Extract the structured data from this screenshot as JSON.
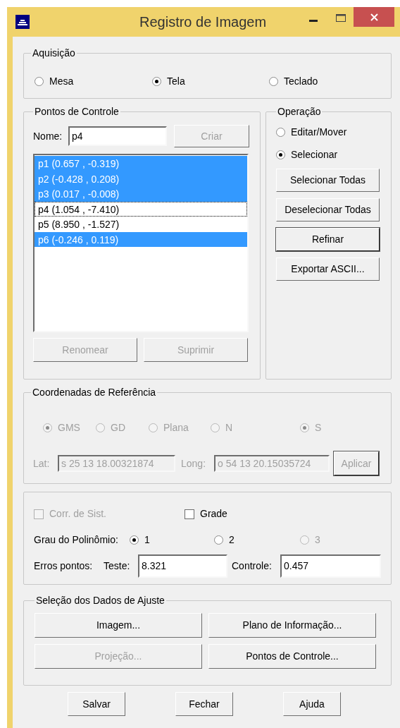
{
  "window": {
    "title": "Registro de Imagem"
  },
  "acquisition": {
    "label": "Aquisição",
    "options": [
      {
        "label": "Mesa",
        "selected": false
      },
      {
        "label": "Tela",
        "selected": true
      },
      {
        "label": "Teclado",
        "selected": false
      }
    ]
  },
  "control_points": {
    "label": "Pontos de Controle",
    "name_label": "Nome:",
    "name_value": "p4",
    "create_button": {
      "label": "Criar",
      "disabled": true
    },
    "points": [
      {
        "label": "p1 (0.657 , -0.319)",
        "selected": true,
        "focused": false
      },
      {
        "label": "p2 (-0.428 , 0.208)",
        "selected": true,
        "focused": false
      },
      {
        "label": "p3 (0.017 , -0.008)",
        "selected": true,
        "focused": false
      },
      {
        "label": "p4 (1.054 , -7.410)",
        "selected": false,
        "focused": true
      },
      {
        "label": "p5 (8.950 , -1.527)",
        "selected": false,
        "focused": false
      },
      {
        "label": "p6 (-0.246 , 0.119)",
        "selected": true,
        "focused": false
      }
    ],
    "buttons": [
      {
        "label": "Renomear",
        "disabled": true
      },
      {
        "label": "Suprimir",
        "disabled": true
      }
    ]
  },
  "operation": {
    "label": "Operação",
    "options": [
      {
        "label": "Editar/Mover",
        "selected": false
      },
      {
        "label": "Selecionar",
        "selected": true
      }
    ],
    "buttons": [
      {
        "label": "Selecionar Todas",
        "default": false
      },
      {
        "label": "Deselecionar Todas",
        "default": false
      },
      {
        "label": "Refinar",
        "default": true
      },
      {
        "label": "Exportar ASCII...",
        "default": false
      }
    ]
  },
  "reference": {
    "label": "Coordenadas de Referência",
    "options": [
      {
        "label": "GMS",
        "selected": true,
        "disabled": true
      },
      {
        "label": "GD",
        "selected": false,
        "disabled": true
      },
      {
        "label": "Plana",
        "selected": false,
        "disabled": true
      },
      {
        "label": "N",
        "selected": false,
        "disabled": true
      },
      {
        "label": "S",
        "selected": true,
        "disabled": true
      }
    ],
    "lat_label": "Lat:",
    "lat_value": "s 25 13 18.00321874",
    "long_label": "Long:",
    "long_value": "o 54 13 20.15035724",
    "apply_button": "Aplicar"
  },
  "adjustment": {
    "checkboxes": [
      {
        "label": "Corr. de Sist.",
        "checked": false,
        "disabled": true
      },
      {
        "label": "Grade",
        "checked": false,
        "disabled": false
      }
    ],
    "degree_label": "Grau do Polinômio:",
    "degree_options": [
      {
        "label": "1",
        "selected": true,
        "disabled": false
      },
      {
        "label": "2",
        "selected": false,
        "disabled": false
      },
      {
        "label": "3",
        "selected": false,
        "disabled": true
      }
    ],
    "errors_label": "Erros pontos:",
    "test_label": "Teste:",
    "test_value": "8.321",
    "control_label": "Controle:",
    "control_value": "0.457"
  },
  "data_selection": {
    "label": "Seleção dos Dados de Ajuste",
    "buttons": [
      {
        "label": "Imagem...",
        "disabled": false
      },
      {
        "label": "Plano de Informação...",
        "disabled": false
      },
      {
        "label": "Projeção...",
        "disabled": true
      },
      {
        "label": "Pontos de Controle...",
        "disabled": false
      }
    ]
  },
  "footer_buttons": [
    "Salvar",
    "Fechar",
    "Ajuda"
  ]
}
